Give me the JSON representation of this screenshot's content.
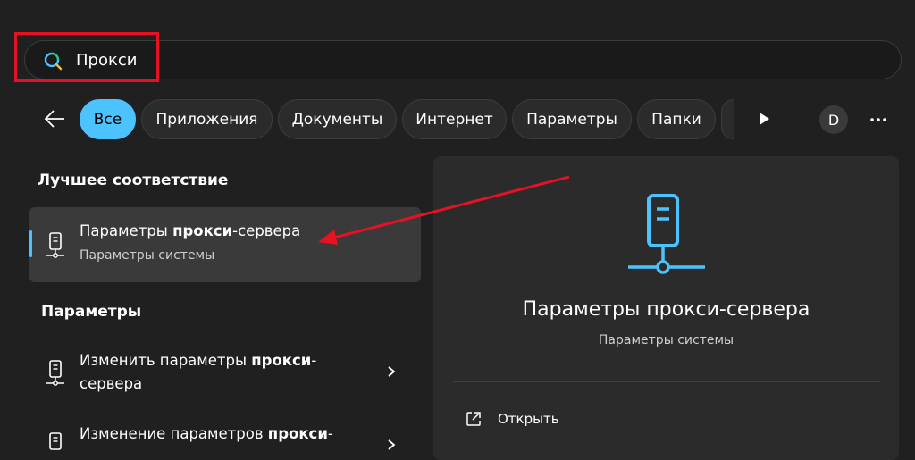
{
  "search": {
    "value": "Прокси"
  },
  "filters": [
    {
      "label": "Все",
      "active": true
    },
    {
      "label": "Приложения"
    },
    {
      "label": "Документы"
    },
    {
      "label": "Интернет"
    },
    {
      "label": "Параметры"
    },
    {
      "label": "Папки"
    }
  ],
  "avatar": {
    "initial": "D"
  },
  "best_match": {
    "section_title": "Лучшее соответствие",
    "title_pre": "Параметры ",
    "title_bold": "прокси",
    "title_post": "-сервера",
    "subtitle": "Параметры системы"
  },
  "settings_section": {
    "title": "Параметры",
    "items": [
      {
        "pre": "Изменить параметры ",
        "bold": "прокси",
        "post": "-сервера"
      },
      {
        "pre": "Изменение параметров ",
        "bold": "прокси",
        "post": "-"
      }
    ]
  },
  "detail": {
    "title": "Параметры прокси-сервера",
    "subtitle": "Параметры системы",
    "open_label": "Открыть"
  },
  "colors": {
    "background": "#202020",
    "accent": "#4cc2ff",
    "highlight_box": "#e81123",
    "annotation_arrow": "#e81123"
  },
  "icons": {
    "search": "search-icon",
    "back": "arrow-left-icon",
    "play": "play-icon",
    "more": "more-horizontal-icon",
    "proxy": "network-proxy-icon",
    "chevron": "chevron-right-icon",
    "open": "open-external-icon"
  }
}
